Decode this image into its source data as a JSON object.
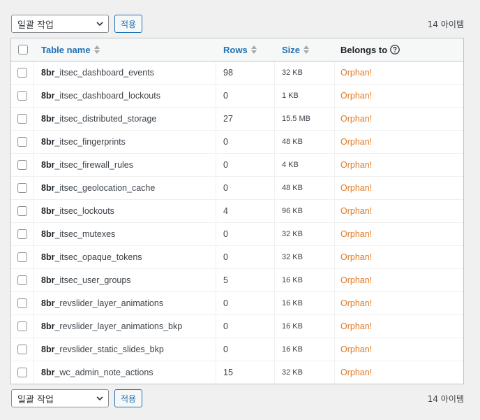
{
  "bulk_actions": {
    "label": "일괄 작업",
    "apply_label": "적용"
  },
  "item_count": "14 아이템",
  "columns": {
    "table_name": "Table name",
    "rows": "Rows",
    "size": "Size",
    "belongs_to": "Belongs to"
  },
  "rows": [
    {
      "prefix": "8br",
      "name": "_itsec_dashboard_events",
      "rows": "98",
      "size": "32 KB",
      "belongs_to": "Orphan!"
    },
    {
      "prefix": "8br",
      "name": "_itsec_dashboard_lockouts",
      "rows": "0",
      "size": "1 KB",
      "belongs_to": "Orphan!"
    },
    {
      "prefix": "8br",
      "name": "_itsec_distributed_storage",
      "rows": "27",
      "size": "15.5 MB",
      "belongs_to": "Orphan!"
    },
    {
      "prefix": "8br",
      "name": "_itsec_fingerprints",
      "rows": "0",
      "size": "48 KB",
      "belongs_to": "Orphan!"
    },
    {
      "prefix": "8br",
      "name": "_itsec_firewall_rules",
      "rows": "0",
      "size": "4 KB",
      "belongs_to": "Orphan!"
    },
    {
      "prefix": "8br",
      "name": "_itsec_geolocation_cache",
      "rows": "0",
      "size": "48 KB",
      "belongs_to": "Orphan!"
    },
    {
      "prefix": "8br",
      "name": "_itsec_lockouts",
      "rows": "4",
      "size": "96 KB",
      "belongs_to": "Orphan!"
    },
    {
      "prefix": "8br",
      "name": "_itsec_mutexes",
      "rows": "0",
      "size": "32 KB",
      "belongs_to": "Orphan!"
    },
    {
      "prefix": "8br",
      "name": "_itsec_opaque_tokens",
      "rows": "0",
      "size": "32 KB",
      "belongs_to": "Orphan!"
    },
    {
      "prefix": "8br",
      "name": "_itsec_user_groups",
      "rows": "5",
      "size": "16 KB",
      "belongs_to": "Orphan!"
    },
    {
      "prefix": "8br",
      "name": "_revslider_layer_animations",
      "rows": "0",
      "size": "16 KB",
      "belongs_to": "Orphan!"
    },
    {
      "prefix": "8br",
      "name": "_revslider_layer_animations_bkp",
      "rows": "0",
      "size": "16 KB",
      "belongs_to": "Orphan!"
    },
    {
      "prefix": "8br",
      "name": "_revslider_static_slides_bkp",
      "rows": "0",
      "size": "16 KB",
      "belongs_to": "Orphan!"
    },
    {
      "prefix": "8br",
      "name": "_wc_admin_note_actions",
      "rows": "15",
      "size": "32 KB",
      "belongs_to": "Orphan!"
    }
  ],
  "colors": {
    "link": "#2271b1",
    "orphan": "#e07b26",
    "border": "#c3c4c7",
    "background": "#f0f0f1"
  },
  "icons": {
    "sort": "sort-arrows-icon",
    "help": "help-circle-icon",
    "dropdown": "chevron-down-icon"
  }
}
